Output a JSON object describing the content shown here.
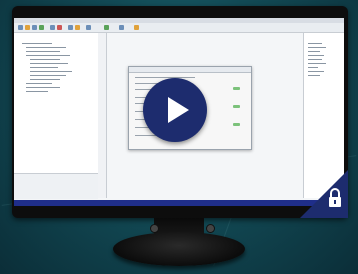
{
  "background": {
    "color": "#124a55"
  },
  "monitor": {
    "bezel_color": "#0d0d0d"
  },
  "screen": {
    "left_panel": {
      "footer_text": ""
    },
    "status_bar_color": "#1f2e8a"
  },
  "video": {
    "play_icon": "play-triangle",
    "play_button_color": "#1d2c6e",
    "lock_icon": "padlock",
    "lock_badge_color": "#1d2c6e"
  }
}
